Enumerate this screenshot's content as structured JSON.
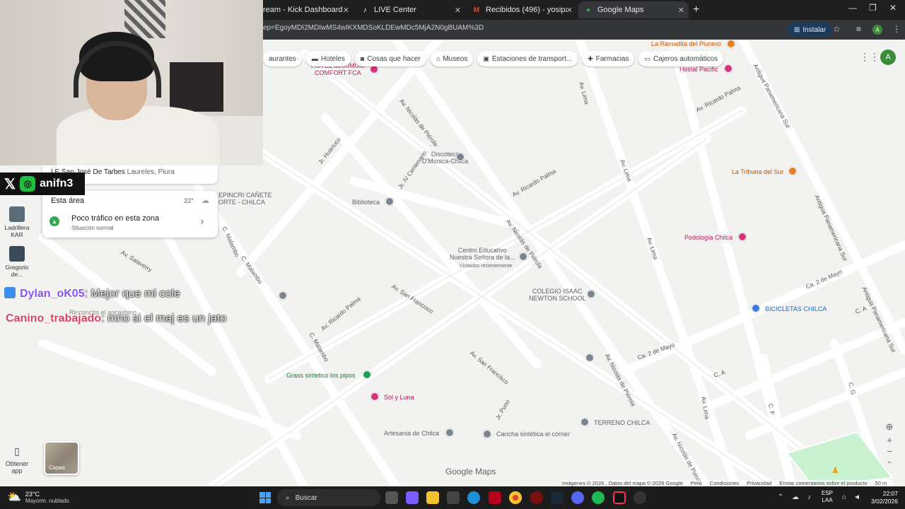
{
  "browser": {
    "tabs": [
      {
        "title": "ream - Kick Dashboard",
        "icon": "kick-icon",
        "active": false
      },
      {
        "title": "LIVE Center",
        "icon": "tiktok-icon",
        "active": false
      },
      {
        "title": "Recibidos (496) - yosipanakin2...",
        "icon": "gmail-icon",
        "active": false
      },
      {
        "title": "Google Maps",
        "icon": "maps-icon",
        "active": true
      }
    ],
    "close_glyph": "✕",
    "new_tab": "+",
    "url": "ep=EgoyMDI2MDIwMS4wIKXMDSoKLDEwMDc5MjA2N0gBUAM%3D",
    "install_label": "Instalar",
    "profile_letter": "A"
  },
  "maps": {
    "chips": [
      {
        "label": "aurantes",
        "icon": ""
      },
      {
        "label": "Hoteles",
        "icon": "bed-icon"
      },
      {
        "label": "Cosas que hacer",
        "icon": "camera-icon"
      },
      {
        "label": "Museos",
        "icon": "museum-icon"
      },
      {
        "label": "Estaciones de transport...",
        "icon": "bus-icon"
      },
      {
        "label": "Farmacias",
        "icon": "pharmacy-icon"
      },
      {
        "label": "Cajeros automáticos",
        "icon": "atm-icon"
      }
    ],
    "account_letter": "A",
    "left_result": {
      "name": "I.E San José De Tarbes",
      "area": "Laureles, Piura"
    },
    "area_card": {
      "title": "Esta área",
      "temperature": "22°",
      "traffic_title": "Poco tráfico en esta zona",
      "traffic_sub": "Situación normal"
    },
    "places": {
      "ramadita": "La Ramadita del Piurano",
      "hostal_pacific": "Hostal Pacific",
      "hotel_maximum": "HOTEL MAXIMUM\nCOMFORT FCA",
      "discoteca": "Discoteca\nD'Monica-Chilca",
      "biblioteca": "Biblioteca",
      "epincri": "EPINCRI CAÑETE\nORTE - CHILCA",
      "centro_educativo": "Centro Educativo\nNuestra Señora de la...",
      "visitados": "Visitados recientemente",
      "colegio": "COLEGIO ISAAC\nNEWTON SCHOOL",
      "tribuna": "La Tribuna del Sur",
      "podologia": "Podología Chilca",
      "bicicletas": "BICICLETAS CHILCA",
      "grass": "Grass sintetico los pipos",
      "sol_luna": "Sol y Luna",
      "artesania": "Artesania de Chilca",
      "cancha": "Cancha sintética el córner",
      "terreno": "TERRENO CHILCA",
      "rinconcito": "Rinconcito el ancashino"
    },
    "streets": {
      "nicolas_pierola": "Av. Nicolás de Piérola",
      "ricardo_palma": "Av. Ricardo Palma",
      "lima": "Av. Lima",
      "jr_huanuco": "Jr. Huanuco",
      "jr_centenario": "Jr. IV Centenario",
      "malambo": "C. Malambo",
      "salaverry": "Av. Salaverry",
      "san_francisco": "Av. San Francisco",
      "dos_mayo": "Ca. 2 de Mayo",
      "panamericana": "Antigua Panamericana Sur",
      "jr_puno": "Jr. Puno",
      "ca": "C. A",
      "cg": "C. G",
      "cf": "C. F"
    },
    "layers_label": "Capas",
    "get_app_label": "Obtener app",
    "google_logo": "Google Maps",
    "footer": [
      "Imágenes © 2026 , Datos del mapa © 2026 Google",
      "Perú",
      "Condiciones",
      "Privacidad",
      "Enviar comentarios sobre el producto",
      "50 m"
    ]
  },
  "overlay": {
    "social_handle": "anifn3",
    "chat": [
      {
        "user": "Dylan_oK05",
        "message": ": Mejor que mi cole"
      },
      {
        "user": "Canino_trabajado",
        "message": ": mno si el maj es un jato"
      }
    ],
    "desktop_icons": [
      {
        "label": "Ladrillera KAR"
      },
      {
        "label": "Gregorio de..."
      }
    ]
  },
  "taskbar": {
    "weather_temp": "23°C",
    "weather_desc": "Mayorm. nublado",
    "search_label": "Buscar",
    "lang_top": "ESP",
    "lang_bottom": "LAA",
    "time": "22:07",
    "date": "3/02/2026"
  }
}
